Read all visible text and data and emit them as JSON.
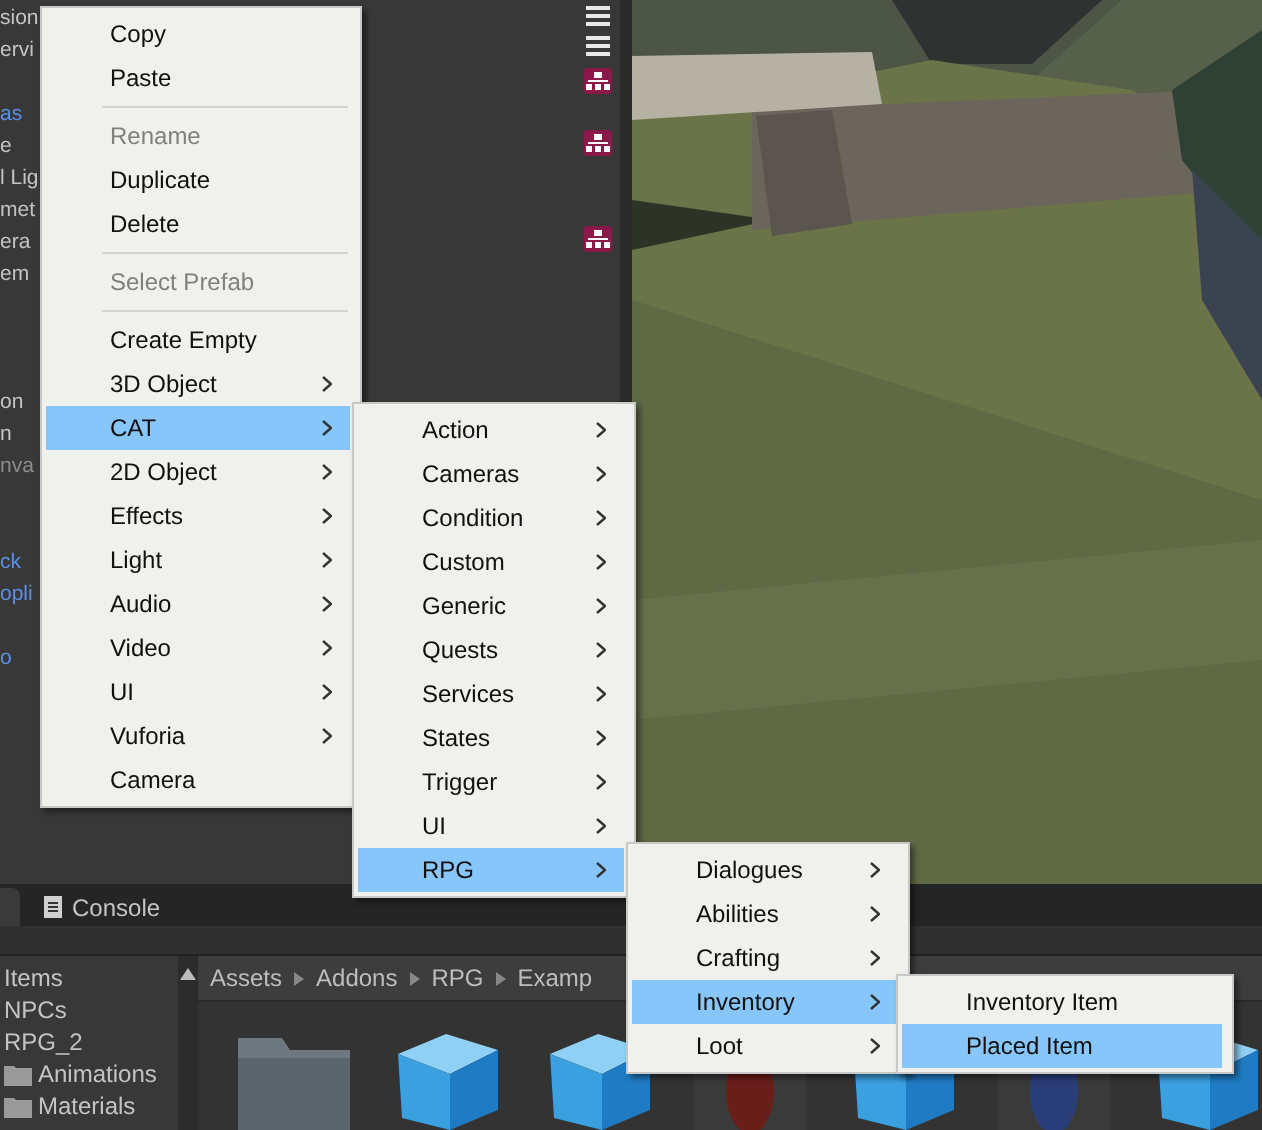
{
  "hierarchy": {
    "items": [
      {
        "text": "sion",
        "kind": "object"
      },
      {
        "text": "ervi",
        "kind": "object"
      },
      {
        "text": "as",
        "kind": "prefab"
      },
      {
        "text": "e",
        "kind": "object"
      },
      {
        "text": "l Lig",
        "kind": "object"
      },
      {
        "text": "met",
        "kind": "object"
      },
      {
        "text": "era",
        "kind": "object"
      },
      {
        "text": "em",
        "kind": "object"
      },
      {
        "text": "on",
        "kind": "object"
      },
      {
        "text": "n",
        "kind": "object"
      },
      {
        "text": "nva",
        "kind": "inactive"
      },
      {
        "text": "ck",
        "kind": "prefab"
      },
      {
        "text": "opli",
        "kind": "prefab"
      },
      {
        "text": "o",
        "kind": "prefab"
      }
    ]
  },
  "bottom_tabs": [
    {
      "label": "Console",
      "selected": false
    }
  ],
  "project": {
    "folders": [
      {
        "label": "Items",
        "icon": false
      },
      {
        "label": "NPCs",
        "icon": false
      },
      {
        "label": "RPG_2",
        "icon": false
      },
      {
        "label": "Animations",
        "icon": true
      },
      {
        "label": "Materials",
        "icon": true
      }
    ],
    "breadcrumb": [
      "Assets",
      "Addons",
      "RPG",
      "Examp"
    ]
  },
  "menus": [
    {
      "items": [
        {
          "kind": "item",
          "label": "Copy",
          "submenu": false,
          "disabled": false,
          "selected": false
        },
        {
          "kind": "item",
          "label": "Paste",
          "submenu": false,
          "disabled": false,
          "selected": false
        },
        {
          "kind": "separator"
        },
        {
          "kind": "item",
          "label": "Rename",
          "submenu": false,
          "disabled": true,
          "selected": false
        },
        {
          "kind": "item",
          "label": "Duplicate",
          "submenu": false,
          "disabled": false,
          "selected": false
        },
        {
          "kind": "item",
          "label": "Delete",
          "submenu": false,
          "disabled": false,
          "selected": false
        },
        {
          "kind": "separator"
        },
        {
          "kind": "item",
          "label": "Select Prefab",
          "submenu": false,
          "disabled": true,
          "selected": false
        },
        {
          "kind": "separator"
        },
        {
          "kind": "item",
          "label": "Create Empty",
          "submenu": false,
          "disabled": false,
          "selected": false
        },
        {
          "kind": "item",
          "label": "3D Object",
          "submenu": true,
          "disabled": false,
          "selected": false
        },
        {
          "kind": "item",
          "label": "CAT",
          "submenu": true,
          "disabled": false,
          "selected": true
        },
        {
          "kind": "item",
          "label": "2D Object",
          "submenu": true,
          "disabled": false,
          "selected": false
        },
        {
          "kind": "item",
          "label": "Effects",
          "submenu": true,
          "disabled": false,
          "selected": false
        },
        {
          "kind": "item",
          "label": "Light",
          "submenu": true,
          "disabled": false,
          "selected": false
        },
        {
          "kind": "item",
          "label": "Audio",
          "submenu": true,
          "disabled": false,
          "selected": false
        },
        {
          "kind": "item",
          "label": "Video",
          "submenu": true,
          "disabled": false,
          "selected": false
        },
        {
          "kind": "item",
          "label": "UI",
          "submenu": true,
          "disabled": false,
          "selected": false
        },
        {
          "kind": "item",
          "label": "Vuforia",
          "submenu": true,
          "disabled": false,
          "selected": false
        },
        {
          "kind": "item",
          "label": "Camera",
          "submenu": false,
          "disabled": false,
          "selected": false
        }
      ]
    },
    {
      "items": [
        {
          "kind": "item",
          "label": "Action",
          "submenu": true,
          "disabled": false,
          "selected": false
        },
        {
          "kind": "item",
          "label": "Cameras",
          "submenu": true,
          "disabled": false,
          "selected": false
        },
        {
          "kind": "item",
          "label": "Condition",
          "submenu": true,
          "disabled": false,
          "selected": false
        },
        {
          "kind": "item",
          "label": "Custom",
          "submenu": true,
          "disabled": false,
          "selected": false
        },
        {
          "kind": "item",
          "label": "Generic",
          "submenu": true,
          "disabled": false,
          "selected": false
        },
        {
          "kind": "item",
          "label": "Quests",
          "submenu": true,
          "disabled": false,
          "selected": false
        },
        {
          "kind": "item",
          "label": "Services",
          "submenu": true,
          "disabled": false,
          "selected": false
        },
        {
          "kind": "item",
          "label": "States",
          "submenu": true,
          "disabled": false,
          "selected": false
        },
        {
          "kind": "item",
          "label": "Trigger",
          "submenu": true,
          "disabled": false,
          "selected": false
        },
        {
          "kind": "item",
          "label": "UI",
          "submenu": true,
          "disabled": false,
          "selected": false
        },
        {
          "kind": "item",
          "label": "RPG",
          "submenu": true,
          "disabled": false,
          "selected": true
        }
      ]
    },
    {
      "items": [
        {
          "kind": "item",
          "label": "Dialogues",
          "submenu": true,
          "disabled": false,
          "selected": false
        },
        {
          "kind": "item",
          "label": "Abilities",
          "submenu": true,
          "disabled": false,
          "selected": false
        },
        {
          "kind": "item",
          "label": "Crafting",
          "submenu": true,
          "disabled": false,
          "selected": false
        },
        {
          "kind": "item",
          "label": "Inventory",
          "submenu": true,
          "disabled": false,
          "selected": true
        },
        {
          "kind": "item",
          "label": "Loot",
          "submenu": true,
          "disabled": false,
          "selected": false
        }
      ]
    },
    {
      "items": [
        {
          "kind": "item",
          "label": "Inventory Item",
          "submenu": false,
          "disabled": false,
          "selected": false
        },
        {
          "kind": "item",
          "label": "Placed Item",
          "submenu": false,
          "disabled": false,
          "selected": true
        }
      ]
    }
  ]
}
